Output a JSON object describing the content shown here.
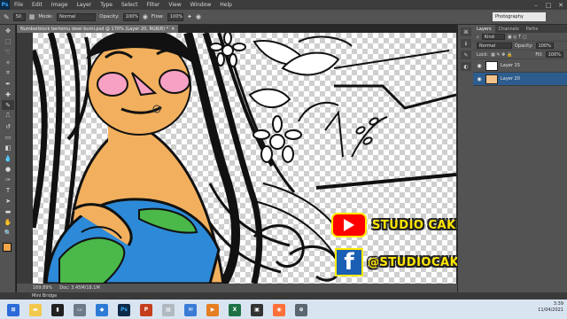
{
  "menubar": {
    "logo": "Ps",
    "items": [
      "File",
      "Edit",
      "Image",
      "Layer",
      "Type",
      "Select",
      "Filter",
      "View",
      "Window",
      "Help"
    ]
  },
  "options": {
    "mode_label": "Mode:",
    "mode_value": "Normal",
    "opacity_label": "Opacity:",
    "opacity_value": "100%",
    "flow_label": "Flow:",
    "flow_value": "100%",
    "size_value": "50",
    "workspace": "Photography"
  },
  "document": {
    "tab_title": "Numberblock bertemu dewi bumi.psd @ 170% (Layer 20, RGB/8) *",
    "zoom": "169.89%",
    "doc_info": "Doc: 3.45M/18.1M"
  },
  "panels": {
    "tabs": [
      "Layers",
      "Channels",
      "Paths"
    ],
    "kind_label": "Kind",
    "blend_mode": "Normal",
    "opacity_label": "Opacity:",
    "opacity_value": "100%",
    "lock_label": "Lock:",
    "fill_label": "Fill:",
    "fill_value": "100%",
    "layers": [
      {
        "name": "Layer 15",
        "selected": false
      },
      {
        "name": "Layer 20",
        "selected": true
      }
    ]
  },
  "watermark": {
    "youtube_text": "STUDIO CAKNINGKAK",
    "facebook_text": "@STUDIOCAKNINGKAK",
    "facebook_glyph": "f"
  },
  "bottom": {
    "mini_bridge": "Mini Bridge",
    "clock_time": "3:39",
    "clock_date": "11/04/2021",
    "ps_label": "Ps"
  },
  "colors": {
    "skin": "#f2b05e",
    "cheek": "#f7a1c4",
    "earth_blue": "#2d8ad8",
    "earth_green": "#4bb84a",
    "selected_layer": "#2d5d8e",
    "fg_swatch": "#f2a54b"
  }
}
